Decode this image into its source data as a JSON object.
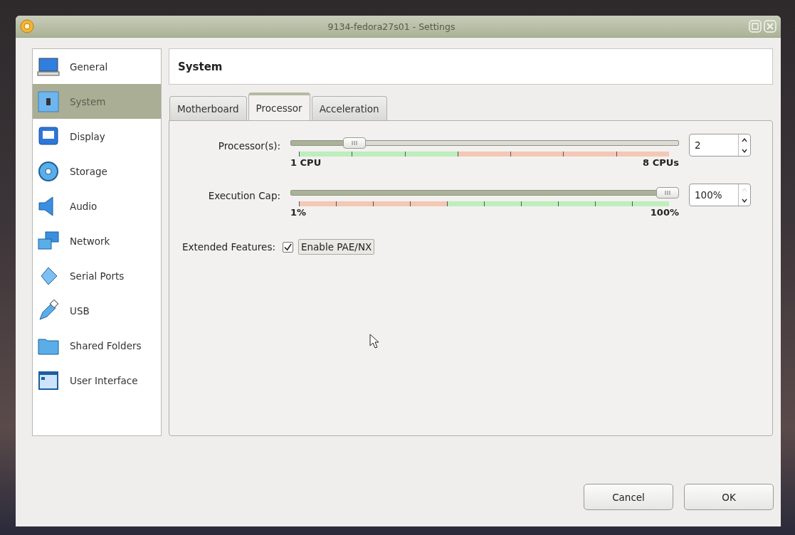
{
  "window": {
    "title": "9134-fedora27s01 - Settings"
  },
  "sidebar": {
    "items": [
      {
        "label": "General",
        "selected": false
      },
      {
        "label": "System",
        "selected": true
      },
      {
        "label": "Display",
        "selected": false
      },
      {
        "label": "Storage",
        "selected": false
      },
      {
        "label": "Audio",
        "selected": false
      },
      {
        "label": "Network",
        "selected": false
      },
      {
        "label": "Serial Ports",
        "selected": false
      },
      {
        "label": "USB",
        "selected": false
      },
      {
        "label": "Shared Folders",
        "selected": false
      },
      {
        "label": "User Interface",
        "selected": false
      }
    ]
  },
  "page_title": "System",
  "tabs": [
    {
      "label": "Motherboard",
      "selected": false
    },
    {
      "label": "Processor",
      "selected": true
    },
    {
      "label": "Acceleration",
      "selected": false
    }
  ],
  "sliders": [
    {
      "label": "Processor(s):",
      "level": 0.143,
      "min_label": "1 CPU",
      "max_label": "8 CPUs",
      "value": "2",
      "up_disabled": false,
      "down_disabled": false,
      "segments": [
        {
          "color": "#bdeebb"
        },
        {
          "color": "#bdeebb"
        },
        {
          "color": "#bdeebb"
        },
        {
          "color": "#f3c8b4"
        },
        {
          "color": "#f3c8b4"
        },
        {
          "color": "#f3c8b4"
        },
        {
          "color": "#f3c8b4"
        }
      ]
    },
    {
      "label": "Execution Cap:",
      "level": 1,
      "min_label": "1%",
      "max_label": "100%",
      "value": "100%",
      "up_disabled": true,
      "down_disabled": false,
      "segments": [
        {
          "color": "#f3c8b4"
        },
        {
          "color": "#f3c8b4"
        },
        {
          "color": "#f3c8b4"
        },
        {
          "color": "#f3c8b4"
        },
        {
          "color": "#bdeebb"
        },
        {
          "color": "#bdeebb"
        },
        {
          "color": "#bdeebb"
        },
        {
          "color": "#bdeebb"
        },
        {
          "color": "#bdeebb"
        },
        {
          "color": "#bdeebb"
        }
      ]
    }
  ],
  "extended_features": {
    "label": "Extended Features:",
    "option": "Enable PAE/NX",
    "checked": true
  },
  "buttons": [
    {
      "label": "Cancel"
    },
    {
      "label": "OK"
    }
  ]
}
